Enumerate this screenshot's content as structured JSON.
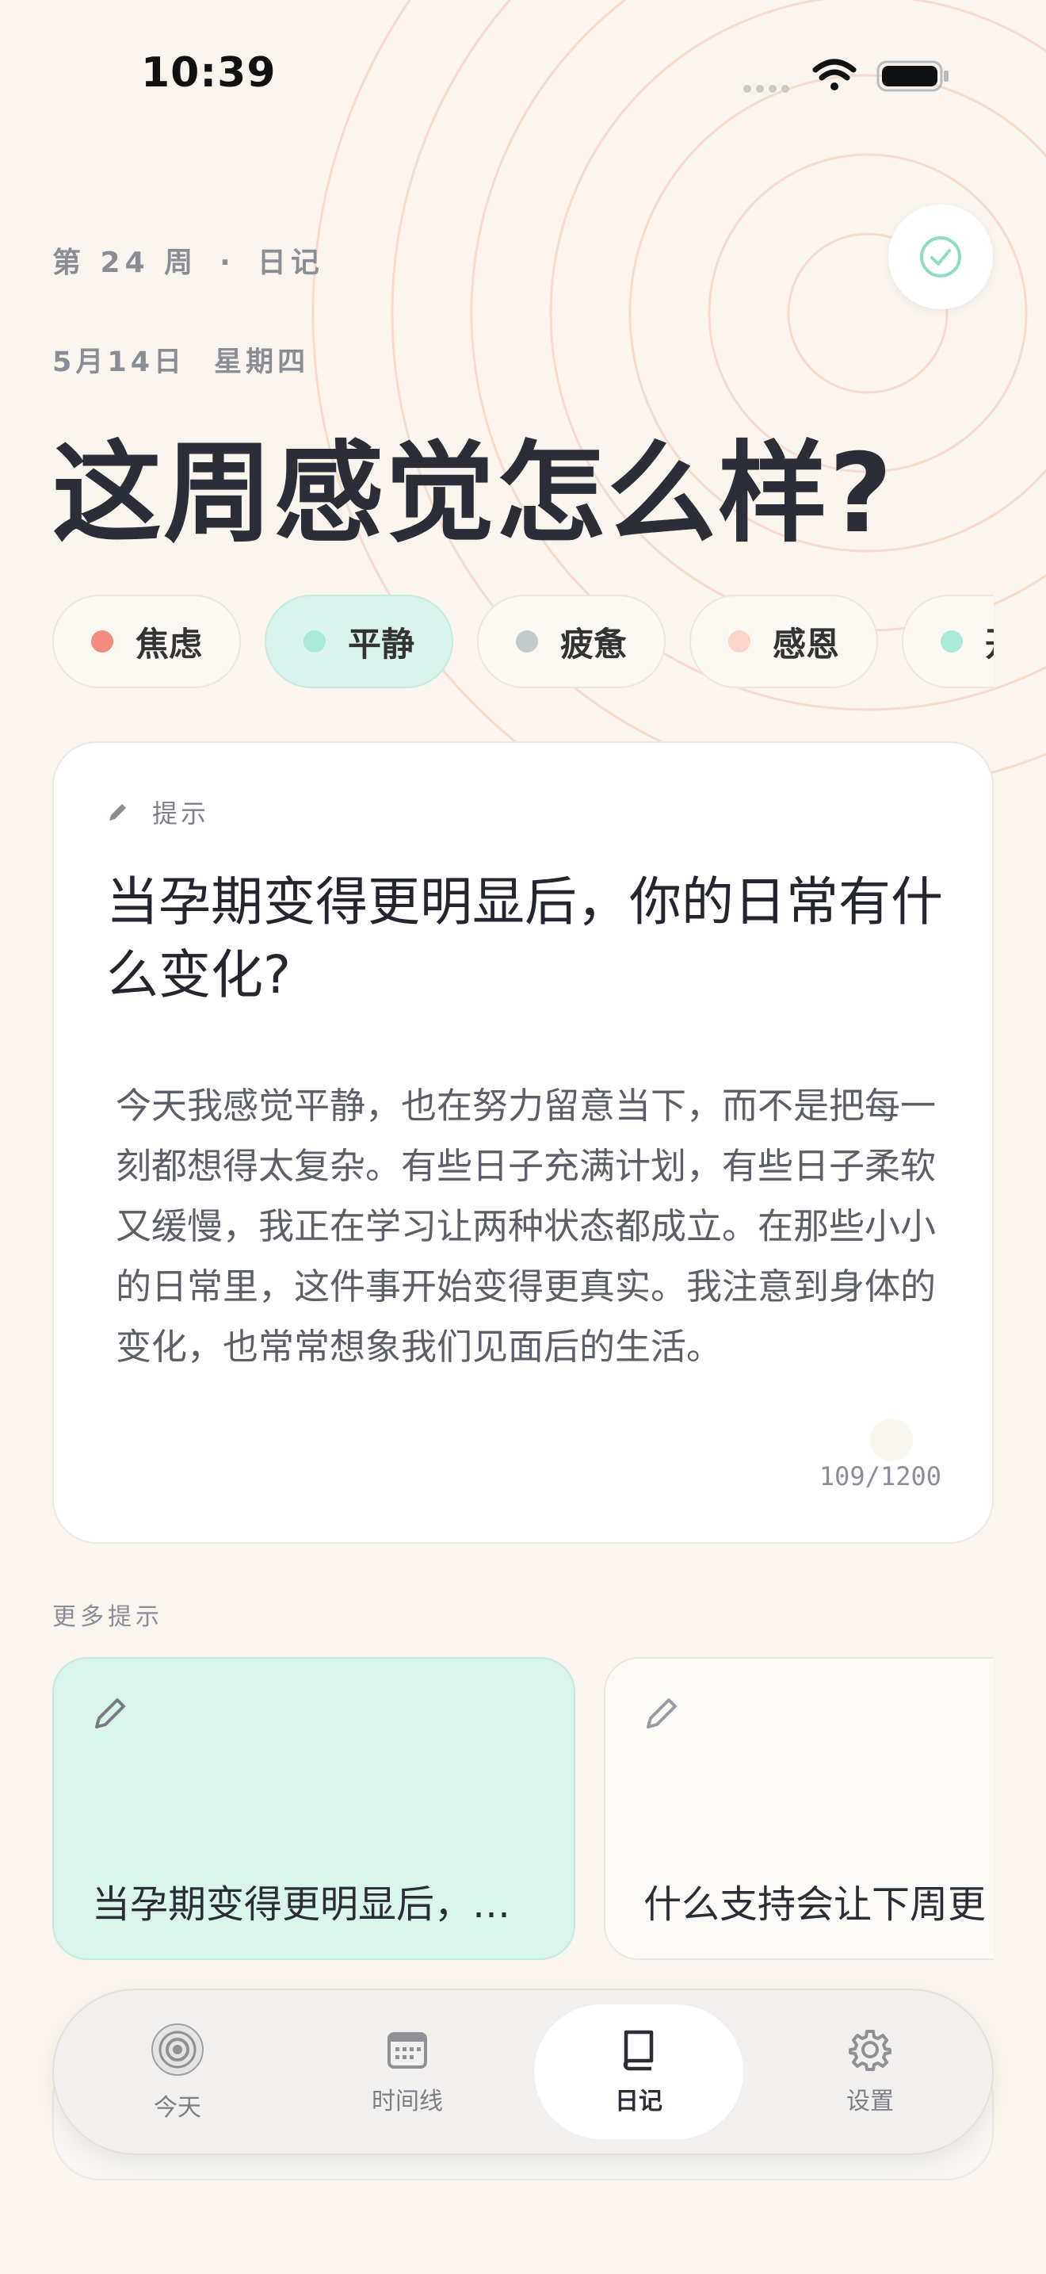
{
  "status_bar": {
    "time": "10:39"
  },
  "header": {
    "week": "第 24 周",
    "separator": "·",
    "section": "日记",
    "date": "5月14日",
    "weekday": "星期四",
    "title": "这周感觉怎么样?"
  },
  "moods": [
    {
      "label": "焦虑",
      "color": "#f28b80"
    },
    {
      "label": "平静",
      "color": "#a9ead8",
      "selected": true
    },
    {
      "label": "疲惫",
      "color": "#c3cac9"
    },
    {
      "label": "感恩",
      "color": "#fbd3c8"
    },
    {
      "label": "开心",
      "color": "#a9ead8"
    }
  ],
  "prompt_card": {
    "hint_label": "提示",
    "question": "当孕期变得更明显后，你的日常有什么变化?",
    "entry_text": "今天我感觉平静，也在努力留意当下，而不是把每一刻都想得太复杂。有些日子充满计划，有些日子柔软又缓慢，我正在学习让两种状态都成立。在那些小小的日常里，这件事开始变得更真实。我注意到身体的变化，也常常想象我们见面后的生活。",
    "char_count": "109/1200"
  },
  "more_prompts": {
    "label": "更多提示",
    "items": [
      {
        "text": "当孕期变得更明显后，…"
      },
      {
        "text": "什么支持会让下周更"
      }
    ]
  },
  "tabbar": {
    "tabs": [
      {
        "label": "今天",
        "icon": "rings-icon"
      },
      {
        "label": "时间线",
        "icon": "calendar-icon"
      },
      {
        "label": "日记",
        "icon": "book-icon",
        "active": true
      },
      {
        "label": "设置",
        "icon": "gear-icon"
      }
    ]
  },
  "colors": {
    "background": "#faf4ee",
    "accent_mint": "#d9f4ec",
    "check_accent": "#8fdcc6",
    "ring": "#f6d9cc"
  }
}
